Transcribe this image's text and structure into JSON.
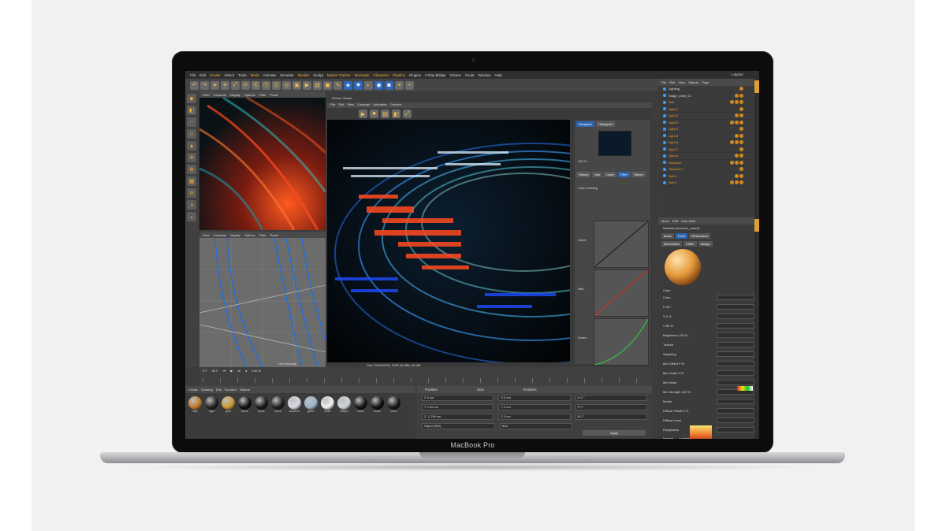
{
  "device": {
    "brand_label": "MacBook Pro"
  },
  "menubar": {
    "items": [
      "File",
      "Edit",
      "Create",
      "Select",
      "Tools",
      "Mesh",
      "Animate",
      "Simulate",
      "Render",
      "Sculpt",
      "Motion Tracker",
      "MoGraph",
      "Character",
      "Pipeline",
      "Plugins",
      "V-Ray Bridge",
      "Octane",
      "Script",
      "Window",
      "Help"
    ],
    "layout_label": "Layout:"
  },
  "viewport_top": {
    "tabs": [
      "View",
      "Cameras",
      "Display",
      "Options",
      "Filter",
      "Panel"
    ],
    "title": "Perspective"
  },
  "viewport_bottom": {
    "tabs": [
      "View",
      "Cameras",
      "Display",
      "Options",
      "Filter",
      "Panel"
    ],
    "grid_label": "Grid Spacing"
  },
  "picture_viewer": {
    "title": "Picture Viewer",
    "tabs": [
      "File",
      "Edit",
      "View",
      "Compare",
      "Animation",
      "Camera"
    ],
    "nav_tabs": [
      "Navigator",
      "Histogram"
    ],
    "zoom": "100 %",
    "sub_tabs": [
      "History",
      "Info",
      "Layer",
      "Filter",
      "Stereo"
    ],
    "color_grading_label": "Color Grading",
    "curve_labels": [
      "Curve",
      "Red",
      "Green"
    ],
    "status": "Size: 2000x2000, RGB (32 Bit), 45 MB"
  },
  "timeline": {
    "current_frame": "0 F",
    "end_frame": "90 F",
    "fps_label": "100 %"
  },
  "material_manager": {
    "tabs": [
      "Create",
      "Shading",
      "Edit",
      "Function",
      "Texture"
    ],
    "materials": [
      {
        "label": "Mat",
        "color": "#c07a2a"
      },
      {
        "label": "Light",
        "color": "#222"
      },
      {
        "label": "gold",
        "color": "#c89a30"
      },
      {
        "label": "black",
        "color": "#111"
      },
      {
        "label": "black",
        "color": "#1a1a1a"
      },
      {
        "label": "black",
        "color": "#202020"
      },
      {
        "label": "structure",
        "color": "#d8d8e8"
      },
      {
        "label": "glass",
        "color": "#9ab4c8"
      },
      {
        "label": "white",
        "color": "#f0f0f0"
      },
      {
        "label": "stripes",
        "color": "#d0d4dc"
      },
      {
        "label": "black",
        "color": "#151515"
      },
      {
        "label": "black",
        "color": "#111"
      },
      {
        "label": "black",
        "color": "#181818"
      }
    ]
  },
  "coordinates": {
    "headers": [
      "Position",
      "Size",
      "Rotation"
    ],
    "rows": [
      [
        "X  0 cm",
        "X  0 cm",
        "H  0 °"
      ],
      [
        "Y  1.26 cm",
        "Y  0 cm",
        "P  0 °"
      ],
      [
        "Z  -1.796 cm",
        "Z  0 cm",
        "B  0 °"
      ]
    ],
    "mode": "Object (Rel)",
    "size_mode": "Size",
    "apply_label": "Apply"
  },
  "object_manager": {
    "tabs": [
      "File",
      "Edit",
      "View",
      "Objects",
      "Tags"
    ],
    "rows": [
      "Lighting",
      "Stage_Lines_01",
      "Null",
      "Light.1",
      "Light.2",
      "Light.3",
      "Light.4",
      "Light.5",
      "Light.6",
      "Light.7",
      "Light.8",
      "Structure",
      "Structure.1",
      "Null.1",
      "Null.2"
    ]
  },
  "attributes": {
    "tabs": [
      "Mode",
      "Edit",
      "User Data"
    ],
    "material_title": "Material [structure_base1]",
    "channel_tabs": [
      "Basic",
      "Color",
      "Reflectance",
      "Illumination",
      "Editor",
      "Assign"
    ],
    "section": "Color",
    "fields": [
      "Color",
      "H  26 °",
      "S  0 %",
      "V  80 %",
      "Brightness  100 %",
      "Texture",
      "Sampling",
      "Blur Offset  0 %",
      "Blur Scale  0 %",
      "Mix Mode",
      "Mix Strength  100 %",
      "Model",
      "Diffuse Falloff  0 %",
      "Diffuse Level",
      "Roughness"
    ],
    "mode_values": [
      "Normal",
      "Lambertian"
    ]
  }
}
